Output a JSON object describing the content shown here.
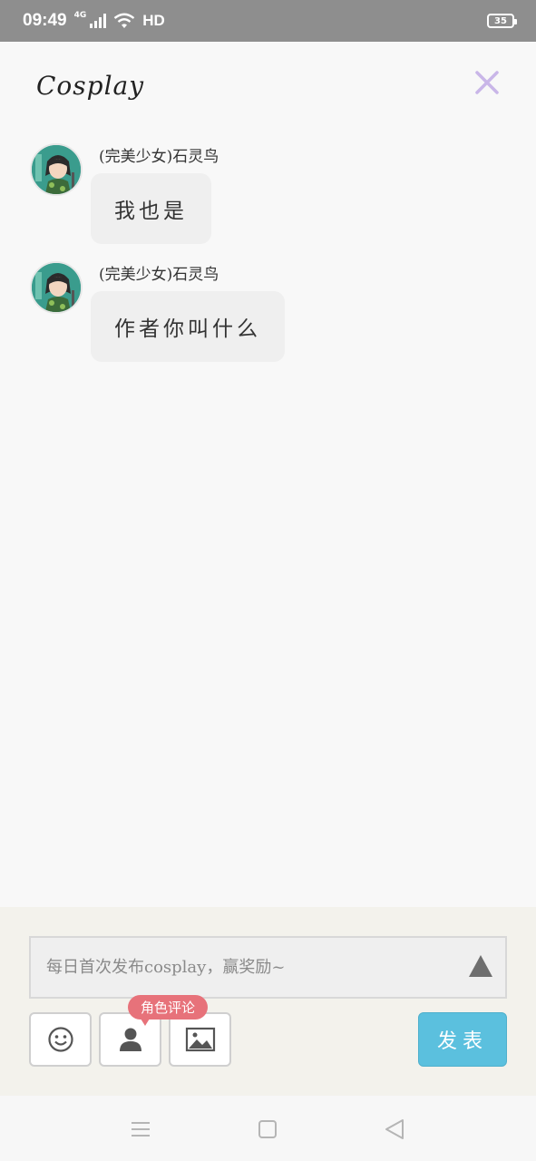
{
  "status_bar": {
    "time": "09:49",
    "network": "4G",
    "hd": "HD",
    "battery": "35"
  },
  "header": {
    "title": "Cosplay",
    "close_icon": "close-icon"
  },
  "messages": [
    {
      "sender": "(完美少女)石灵鸟",
      "text": "我也是",
      "avatar": "avatar"
    },
    {
      "sender": "(完美少女)石灵鸟",
      "text": "作者你叫什么",
      "avatar": "avatar"
    }
  ],
  "composer": {
    "placeholder": "每日首次发布cosplay，赢奖励~",
    "expand_icon": "triangle-up-icon",
    "tools": [
      {
        "icon": "emoji-icon"
      },
      {
        "icon": "person-icon"
      },
      {
        "icon": "image-icon"
      }
    ],
    "tooltip": "角色评论",
    "publish_label": "发表"
  },
  "colors": {
    "status_bar": "#8e8e8e",
    "close": "#c9b6e8",
    "bubble": "#efefef",
    "panel": "#f3f2ec",
    "tooltip": "#e7727a",
    "publish": "#5bc0de"
  },
  "nav_bar": {
    "icons": [
      "menu-icon",
      "home-square-icon",
      "back-triangle-icon"
    ]
  }
}
